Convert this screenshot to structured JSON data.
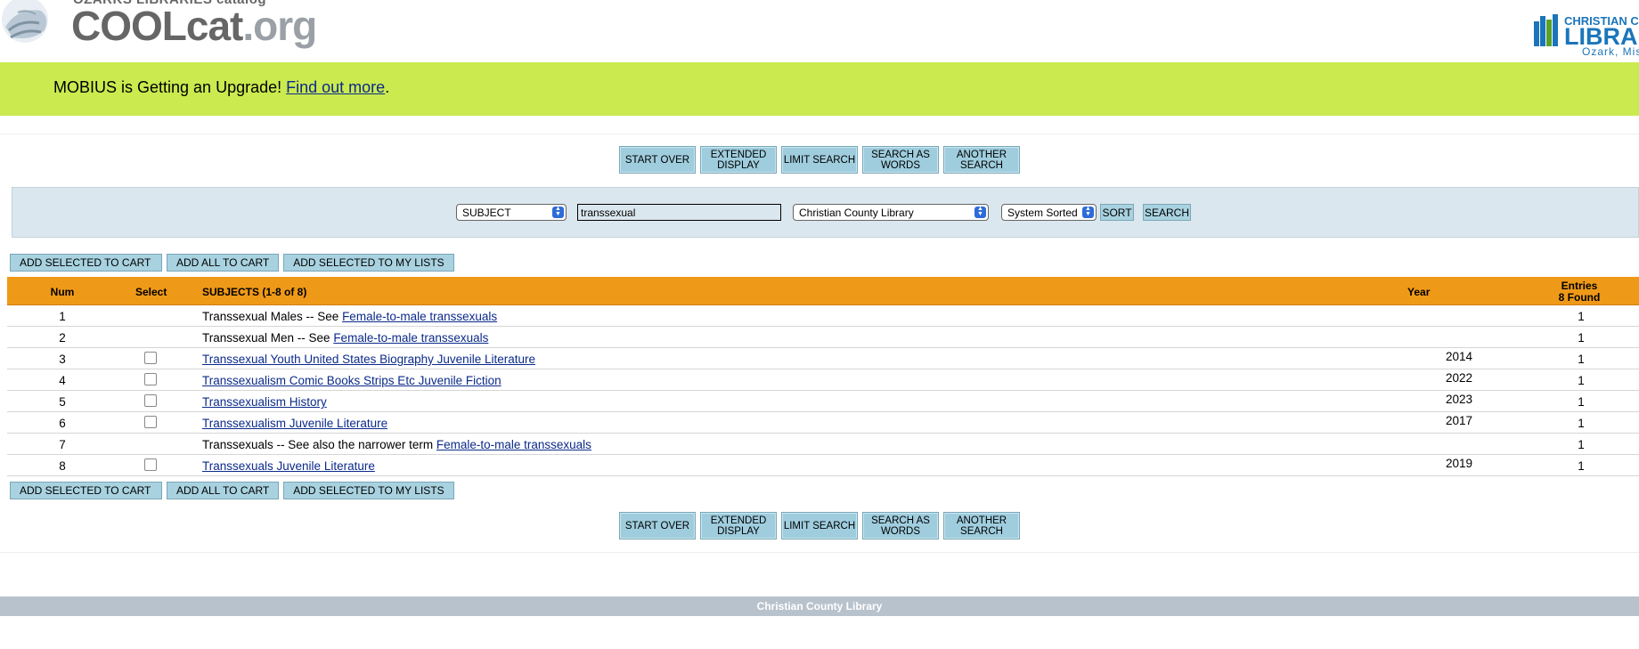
{
  "header": {
    "sub_title": "OZARKS LIBRARIES catalog",
    "logo_main": "COOLcat",
    "logo_tld": ".org",
    "right_logo_top": "CHRISTIAN CO",
    "right_logo_mid": "LIBRAR",
    "right_logo_bottom": "Ozark, Mis"
  },
  "banner": {
    "text_before": "MOBIUS is Getting an Upgrade! ",
    "link": "Find out more",
    "text_after": "."
  },
  "nav_buttons": [
    "START OVER",
    "EXTENDED DISPLAY",
    "LIMIT SEARCH",
    "SEARCH AS WORDS",
    "ANOTHER SEARCH"
  ],
  "search": {
    "type": "SUBJECT",
    "query": "transsexual",
    "library": "Christian County Library",
    "sort_select": "System Sorted",
    "sort_label": "SORT",
    "search_label": "SEARCH"
  },
  "cart_buttons": [
    "ADD SELECTED TO CART",
    "ADD ALL TO CART",
    "ADD SELECTED TO MY LISTS"
  ],
  "table": {
    "headers": {
      "num": "Num",
      "select": "Select",
      "subjects": "SUBJECTS (1-8 of 8)",
      "year": "Year",
      "entries_line1": "Entries",
      "entries_line2": "8 Found"
    },
    "rows": [
      {
        "num": "1",
        "checkbox": false,
        "text": "Transsexual Males -- See ",
        "link": "Female-to-male transsexuals",
        "year": "",
        "entries": "1"
      },
      {
        "num": "2",
        "checkbox": false,
        "text": "Transsexual Men -- See ",
        "link": "Female-to-male transsexuals",
        "year": "",
        "entries": "1"
      },
      {
        "num": "3",
        "checkbox": true,
        "text": "",
        "link": "Transsexual Youth United States Biography Juvenile Literature",
        "year": "2014",
        "entries": "1"
      },
      {
        "num": "4",
        "checkbox": true,
        "text": "",
        "link": "Transsexualism Comic Books Strips Etc Juvenile Fiction",
        "year": "2022",
        "entries": "1"
      },
      {
        "num": "5",
        "checkbox": true,
        "text": "",
        "link": "Transsexualism History",
        "year": "2023",
        "entries": "1"
      },
      {
        "num": "6",
        "checkbox": true,
        "text": "",
        "link": "Transsexualism Juvenile Literature",
        "year": "2017",
        "entries": "1"
      },
      {
        "num": "7",
        "checkbox": false,
        "text": "Transsexuals -- See also the narrower term ",
        "link": "Female-to-male transsexuals",
        "year": "",
        "entries": "1"
      },
      {
        "num": "8",
        "checkbox": true,
        "text": "",
        "link": "Transsexuals Juvenile Literature",
        "year": "2019",
        "entries": "1"
      }
    ]
  },
  "footer": {
    "text": "Christian County Library"
  },
  "colors": {
    "banner": "#cbea4f",
    "table_header": "#ef9918",
    "button": "#a9d2e0",
    "link": "#0b2a8a",
    "footer": "#b8c2cc"
  }
}
